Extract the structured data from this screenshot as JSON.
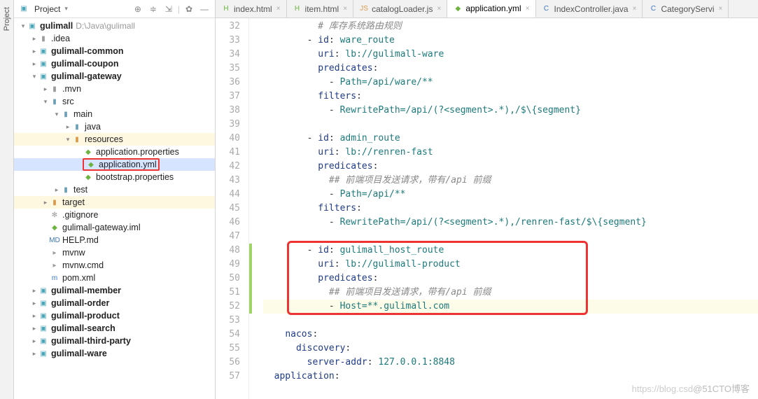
{
  "sideTab": "Project",
  "panelHeader": {
    "label": "Project"
  },
  "tree": [
    {
      "depth": 0,
      "arrow": "open",
      "iconCls": "folder-cyan",
      "glyph": "▣",
      "label": "gulimall",
      "bold": true,
      "path": "D:\\Java\\gulimall",
      "name": "project-root"
    },
    {
      "depth": 1,
      "arrow": "closed",
      "iconCls": "folder-gray",
      "glyph": "▮",
      "label": ".idea",
      "name": "folder-idea"
    },
    {
      "depth": 1,
      "arrow": "closed",
      "iconCls": "folder-cyan",
      "glyph": "▣",
      "label": "gulimall-common",
      "bold": true,
      "name": "module-common"
    },
    {
      "depth": 1,
      "arrow": "closed",
      "iconCls": "folder-cyan",
      "glyph": "▣",
      "label": "gulimall-coupon",
      "bold": true,
      "name": "module-coupon"
    },
    {
      "depth": 1,
      "arrow": "open",
      "iconCls": "folder-cyan",
      "glyph": "▣",
      "label": "gulimall-gateway",
      "bold": true,
      "name": "module-gateway"
    },
    {
      "depth": 2,
      "arrow": "closed",
      "iconCls": "folder-gray",
      "glyph": "▮",
      ".label": "",
      "label": ".mvn",
      "name": "folder-mvn"
    },
    {
      "depth": 2,
      "arrow": "open",
      "iconCls": "folder-blue",
      "glyph": "▮",
      "label": "src",
      "name": "folder-src"
    },
    {
      "depth": 3,
      "arrow": "open",
      "iconCls": "folder-blue",
      "glyph": "▮",
      "label": "main",
      "name": "folder-main"
    },
    {
      "depth": 4,
      "arrow": "closed",
      "iconCls": "folder-blue",
      "glyph": "▮",
      "label": "java",
      "name": "folder-java"
    },
    {
      "depth": 4,
      "arrow": "open",
      "iconCls": "folder-orange",
      "glyph": "▮",
      "label": "resources",
      "name": "folder-resources",
      "rowCls": "highlighted"
    },
    {
      "depth": 5,
      "arrow": "none",
      "iconCls": "file-green",
      "glyph": "◆",
      "label": "application.properties",
      "name": "file-app-properties"
    },
    {
      "depth": 5,
      "arrow": "none",
      "iconCls": "file-green",
      "glyph": "◆",
      "label": "application.yml",
      "name": "file-app-yml",
      "rowCls": "selected",
      "redbox": true
    },
    {
      "depth": 5,
      "arrow": "none",
      "iconCls": "file-green",
      "glyph": "◆",
      "label": "bootstrap.properties",
      "name": "file-bootstrap-properties"
    },
    {
      "depth": 3,
      "arrow": "closed",
      "iconCls": "folder-blue",
      "glyph": "▮",
      "label": "test",
      "name": "folder-test"
    },
    {
      "depth": 2,
      "arrow": "closed",
      "iconCls": "folder-orange",
      "glyph": "▮",
      "label": "target",
      "name": "folder-target",
      "rowCls": "highlighted"
    },
    {
      "depth": 2,
      "arrow": "none",
      "iconCls": "file-gray",
      "glyph": "✻",
      "label": ".gitignore",
      "name": "file-gitignore"
    },
    {
      "depth": 2,
      "arrow": "none",
      "iconCls": "file-green",
      "glyph": "◆",
      "label": "gulimall-gateway.iml",
      "name": "file-iml"
    },
    {
      "depth": 2,
      "arrow": "none",
      "iconCls": "file-blue",
      "glyph": "MD",
      "label": "HELP.md",
      "name": "file-help"
    },
    {
      "depth": 2,
      "arrow": "none",
      "iconCls": "file-gray",
      "glyph": "▸",
      "label": "mvnw",
      "name": "file-mvnw"
    },
    {
      "depth": 2,
      "arrow": "none",
      "iconCls": "file-gray",
      "glyph": "▸",
      "label": "mvnw.cmd",
      "name": "file-mvnw-cmd"
    },
    {
      "depth": 2,
      "arrow": "none",
      "iconCls": "file-blue",
      "glyph": "m",
      "label": "pom.xml",
      "name": "file-pom"
    },
    {
      "depth": 1,
      "arrow": "closed",
      "iconCls": "folder-cyan",
      "glyph": "▣",
      "label": "gulimall-member",
      "bold": true,
      "name": "module-member"
    },
    {
      "depth": 1,
      "arrow": "closed",
      "iconCls": "folder-cyan",
      "glyph": "▣",
      "label": "gulimall-order",
      "bold": true,
      "name": "module-order"
    },
    {
      "depth": 1,
      "arrow": "closed",
      "iconCls": "folder-cyan",
      "glyph": "▣",
      "label": "gulimall-product",
      "bold": true,
      "name": "module-product"
    },
    {
      "depth": 1,
      "arrow": "closed",
      "iconCls": "folder-cyan",
      "glyph": "▣",
      "label": "gulimall-search",
      "bold": true,
      "name": "module-search"
    },
    {
      "depth": 1,
      "arrow": "closed",
      "iconCls": "folder-cyan",
      "glyph": "▣",
      "label": "gulimall-third-party",
      "bold": true,
      "name": "module-third-party"
    },
    {
      "depth": 1,
      "arrow": "closed",
      "iconCls": "folder-cyan",
      "glyph": "▣",
      "label": "gulimall-ware",
      "bold": true,
      "name": "module-ware"
    }
  ],
  "tabs": [
    {
      "icon": "H",
      "iconCls": "file-green",
      "label": "index.html",
      "name": "tab-index-html"
    },
    {
      "icon": "H",
      "iconCls": "file-green",
      "label": "item.html",
      "name": "tab-item-html"
    },
    {
      "icon": "JS",
      "iconCls": "folder-orange",
      "label": "catalogLoader.js",
      "name": "tab-catalogloader"
    },
    {
      "icon": "◆",
      "iconCls": "file-green",
      "label": "application.yml",
      "name": "tab-application-yml",
      "active": true
    },
    {
      "icon": "C",
      "iconCls": "file-blue",
      "label": "IndexController.java",
      "name": "tab-indexcontroller"
    },
    {
      "icon": "C",
      "iconCls": "file-blue",
      "label": "CategoryServi",
      "name": "tab-categoryservice"
    }
  ],
  "code": {
    "startLine": 32,
    "lines": [
      {
        "n": 32,
        "html": "          <span class='k-gray'># 库存系统路由规则</span>"
      },
      {
        "n": 33,
        "html": "        - <span class='k-blue'>id</span>: <span class='k-teal'>ware_route</span>"
      },
      {
        "n": 34,
        "html": "          <span class='k-blue'>uri</span>: <span class='k-teal'>lb://gulimall-ware</span>"
      },
      {
        "n": 35,
        "html": "          <span class='k-blue'>predicates</span>:"
      },
      {
        "n": 36,
        "html": "            - <span class='k-teal'>Path=/api/ware/**</span>"
      },
      {
        "n": 37,
        "html": "          <span class='k-blue'>filters</span>:"
      },
      {
        "n": 38,
        "html": "            - <span class='k-teal'>RewritePath=/api/(?&lt;segment&gt;.*),/$\\{segment}</span>"
      },
      {
        "n": 39,
        "html": ""
      },
      {
        "n": 40,
        "html": "        - <span class='k-blue'>id</span>: <span class='k-teal'>admin_route</span>"
      },
      {
        "n": 41,
        "html": "          <span class='k-blue'>uri</span>: <span class='k-teal'>lb://renren-fast</span>"
      },
      {
        "n": 42,
        "html": "          <span class='k-blue'>predicates</span>:"
      },
      {
        "n": 43,
        "html": "            <span class='k-gray'>## 前端项目发送请求，带有/api 前缀</span>"
      },
      {
        "n": 44,
        "html": "            - <span class='k-teal'>Path=/api/**</span>"
      },
      {
        "n": 45,
        "html": "          <span class='k-blue'>filters</span>:"
      },
      {
        "n": 46,
        "html": "            - <span class='k-teal'>RewritePath=/api/(?&lt;segment&gt;.*),/renren-fast/$\\{segment}</span>"
      },
      {
        "n": 47,
        "html": ""
      },
      {
        "n": 48,
        "html": "        - <span class='k-blue'>id</span>: <span class='k-teal'>gulimall_host_route</span>",
        "marker": "green"
      },
      {
        "n": 49,
        "html": "          <span class='k-blue'>uri</span>: <span class='k-teal'>lb://gulimall-product</span>",
        "marker": "green"
      },
      {
        "n": 50,
        "html": "          <span class='k-blue'>predicates</span>:",
        "marker": "green"
      },
      {
        "n": 51,
        "html": "            <span class='k-gray'>## 前端项目发送请求，带有/api 前缀</span>",
        "marker": "green"
      },
      {
        "n": 52,
        "html": "            - <span class='k-teal'>Host=**.gulimall.com</span>",
        "marker": "green",
        "hl": true
      },
      {
        "n": 53,
        "html": ""
      },
      {
        "n": 54,
        "html": "    <span class='k-blue'>nacos</span>:"
      },
      {
        "n": 55,
        "html": "      <span class='k-blue'>discovery</span>:"
      },
      {
        "n": 56,
        "html": "        <span class='k-blue'>server-addr</span>: <span class='k-teal'>127.0.0.1:8848</span>"
      },
      {
        "n": 57,
        "html": "  <span class='k-blue'>application</span>:"
      }
    ],
    "redBox": {
      "startLine": 48,
      "endLine": 52
    }
  },
  "watermark": {
    "faint": "https://blog.csd",
    "brand": "@51CTO博客"
  }
}
